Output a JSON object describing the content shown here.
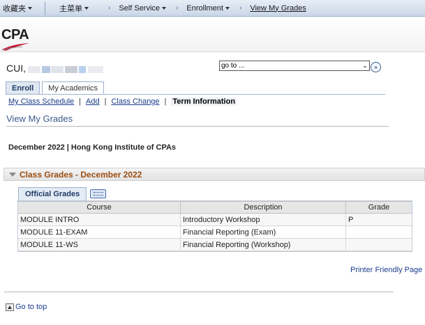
{
  "topnav": {
    "favorites": "收藏夹",
    "main_menu": "主菜单",
    "self_service": "Self Service",
    "enrollment": "Enrollment",
    "current": "View My Grades"
  },
  "logo": {
    "text": "CPA"
  },
  "user": {
    "name_prefix": "CUI,"
  },
  "goto": {
    "value": "go to ..."
  },
  "tabs": [
    {
      "label": "Enroll"
    },
    {
      "label": "My Academics"
    }
  ],
  "sublinks": {
    "schedule": "My Class Schedule",
    "add": "Add",
    "change": "Class Change",
    "term_info": "Term Information",
    "separator": "|"
  },
  "page_title": "View My Grades",
  "term_label": "December 2022 | Hong Kong Institute of CPAs",
  "grades_section": {
    "title": "Class Grades - December 2022"
  },
  "grid": {
    "tab_label": "Official Grades",
    "columns": [
      "Course",
      "Description",
      "Grade"
    ],
    "rows": [
      {
        "course": "MODULE INTRO",
        "description": "Introductory Workshop",
        "grade": "P"
      },
      {
        "course": "MODULE 11-EXAM",
        "description": "Financial Reporting (Exam)",
        "grade": ""
      },
      {
        "course": "MODULE 11-WS",
        "description": "Financial Reporting (Workshop)",
        "grade": ""
      }
    ]
  },
  "printer_link": "Printer Friendly Page",
  "go_to_top": "Go to top",
  "colors": {
    "link": "#1a3d8c",
    "section_title": "#9c4d10",
    "nav_bg": "#c9d6e8"
  }
}
